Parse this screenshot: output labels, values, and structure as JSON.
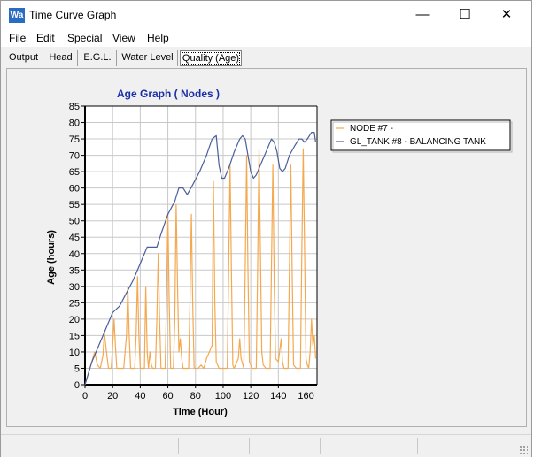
{
  "window": {
    "title": "Time Curve Graph",
    "icon_text": "Wa",
    "controls": {
      "minimize": "—",
      "maximize": "☐",
      "close": "✕"
    }
  },
  "menu": {
    "items": [
      {
        "label": "File"
      },
      {
        "label": "Edit"
      },
      {
        "label": "Special"
      },
      {
        "label": "View"
      },
      {
        "label": "Help"
      }
    ]
  },
  "tabs": [
    {
      "label": "Output",
      "active": false
    },
    {
      "label": "Head",
      "active": false
    },
    {
      "label": "E.G.L.",
      "active": false
    },
    {
      "label": "Water Level",
      "active": false
    },
    {
      "label": "Quality (Age)",
      "active": true
    }
  ],
  "colors": {
    "node_series": "#f4a950",
    "tank_series": "#4a5f9a",
    "title": "#1a2ea8",
    "grid": "#c8c8c8"
  },
  "chart_data": {
    "type": "line",
    "title": "Age Graph ( Nodes )",
    "xlabel": "Time (Hour)",
    "ylabel": "Age (hours)",
    "xlim": [
      0,
      168
    ],
    "ylim": [
      0,
      85
    ],
    "x_ticks": [
      0,
      20,
      40,
      60,
      80,
      100,
      120,
      140,
      160
    ],
    "y_ticks": [
      0,
      5,
      10,
      15,
      20,
      25,
      30,
      35,
      40,
      45,
      50,
      55,
      60,
      65,
      70,
      75,
      80,
      85
    ],
    "grid": true,
    "legend_position": "top-right-outside",
    "series": [
      {
        "name": "NODE #7 -",
        "points": [
          [
            0,
            0
          ],
          [
            7,
            10
          ],
          [
            9,
            6
          ],
          [
            11,
            5
          ],
          [
            13,
            9
          ],
          [
            14,
            16
          ],
          [
            15,
            12
          ],
          [
            17,
            5
          ],
          [
            19,
            5
          ],
          [
            20,
            12
          ],
          [
            21,
            20
          ],
          [
            22,
            12
          ],
          [
            23,
            5
          ],
          [
            28,
            5
          ],
          [
            30,
            15
          ],
          [
            31,
            30
          ],
          [
            32,
            15
          ],
          [
            33,
            5
          ],
          [
            36,
            5
          ],
          [
            37,
            15
          ],
          [
            38,
            33
          ],
          [
            39,
            15
          ],
          [
            40,
            5
          ],
          [
            43,
            5
          ],
          [
            44,
            30
          ],
          [
            45,
            10
          ],
          [
            46,
            5
          ],
          [
            47,
            10
          ],
          [
            48,
            6
          ],
          [
            49,
            5
          ],
          [
            51,
            5
          ],
          [
            52,
            20
          ],
          [
            53,
            40
          ],
          [
            54,
            20
          ],
          [
            55,
            5
          ],
          [
            58,
            5
          ],
          [
            59,
            25
          ],
          [
            60,
            52
          ],
          [
            61,
            25
          ],
          [
            62,
            5
          ],
          [
            64,
            5
          ],
          [
            65,
            20
          ],
          [
            66,
            55
          ],
          [
            67,
            30
          ],
          [
            68,
            10
          ],
          [
            69,
            14
          ],
          [
            70,
            8
          ],
          [
            71,
            5
          ],
          [
            75,
            5
          ],
          [
            76,
            25
          ],
          [
            77,
            52
          ],
          [
            78,
            25
          ],
          [
            79,
            5
          ],
          [
            82,
            5
          ],
          [
            84,
            6
          ],
          [
            86,
            5
          ],
          [
            88,
            8
          ],
          [
            90,
            10
          ],
          [
            92,
            12
          ],
          [
            93,
            62
          ],
          [
            94,
            25
          ],
          [
            95,
            7
          ],
          [
            97,
            5
          ],
          [
            103,
            5
          ],
          [
            104,
            35
          ],
          [
            105,
            67
          ],
          [
            106,
            35
          ],
          [
            107,
            6
          ],
          [
            108,
            5
          ],
          [
            111,
            8
          ],
          [
            112,
            14
          ],
          [
            113,
            8
          ],
          [
            115,
            5
          ],
          [
            116,
            35
          ],
          [
            117,
            70
          ],
          [
            118,
            35
          ],
          [
            119,
            7
          ],
          [
            121,
            5
          ],
          [
            124,
            5
          ],
          [
            125,
            35
          ],
          [
            126,
            72
          ],
          [
            127,
            40
          ],
          [
            128,
            10
          ],
          [
            129,
            6
          ],
          [
            131,
            5
          ],
          [
            134,
            5
          ],
          [
            135,
            35
          ],
          [
            136,
            67
          ],
          [
            137,
            30
          ],
          [
            138,
            8
          ],
          [
            140,
            7
          ],
          [
            142,
            14
          ],
          [
            143,
            7
          ],
          [
            144,
            5
          ],
          [
            147,
            5
          ],
          [
            148,
            35
          ],
          [
            149,
            67
          ],
          [
            150,
            35
          ],
          [
            151,
            6
          ],
          [
            153,
            5
          ],
          [
            156,
            5
          ],
          [
            157,
            40
          ],
          [
            158,
            72
          ],
          [
            159,
            40
          ],
          [
            160,
            8
          ],
          [
            161,
            6
          ],
          [
            162,
            5
          ],
          [
            163,
            10
          ],
          [
            164,
            20
          ],
          [
            165,
            12
          ],
          [
            166,
            15
          ],
          [
            167,
            8
          ]
        ]
      },
      {
        "name": "GL_TANK #8 - BALANCING TANK",
        "points": [
          [
            0,
            0
          ],
          [
            5,
            7
          ],
          [
            10,
            12
          ],
          [
            15,
            17
          ],
          [
            20,
            22
          ],
          [
            25,
            24
          ],
          [
            30,
            28
          ],
          [
            35,
            32
          ],
          [
            40,
            37
          ],
          [
            45,
            42
          ],
          [
            50,
            42
          ],
          [
            52,
            42
          ],
          [
            55,
            46
          ],
          [
            60,
            52
          ],
          [
            65,
            56
          ],
          [
            68,
            60
          ],
          [
            71,
            60
          ],
          [
            74,
            58
          ],
          [
            78,
            61
          ],
          [
            83,
            65
          ],
          [
            88,
            70
          ],
          [
            92,
            75
          ],
          [
            95,
            76
          ],
          [
            97,
            67
          ],
          [
            99,
            63
          ],
          [
            101,
            63
          ],
          [
            104,
            66
          ],
          [
            108,
            71
          ],
          [
            112,
            75
          ],
          [
            114,
            76
          ],
          [
            116,
            75
          ],
          [
            118,
            70
          ],
          [
            120,
            65
          ],
          [
            122,
            63
          ],
          [
            124,
            64
          ],
          [
            128,
            68
          ],
          [
            132,
            72
          ],
          [
            135,
            75
          ],
          [
            137,
            74
          ],
          [
            139,
            71
          ],
          [
            141,
            66
          ],
          [
            143,
            65
          ],
          [
            145,
            66
          ],
          [
            148,
            70
          ],
          [
            152,
            73
          ],
          [
            155,
            75
          ],
          [
            157,
            75
          ],
          [
            159,
            74
          ],
          [
            161,
            75
          ],
          [
            164,
            77
          ],
          [
            166,
            77
          ],
          [
            167,
            74
          ]
        ]
      }
    ]
  }
}
